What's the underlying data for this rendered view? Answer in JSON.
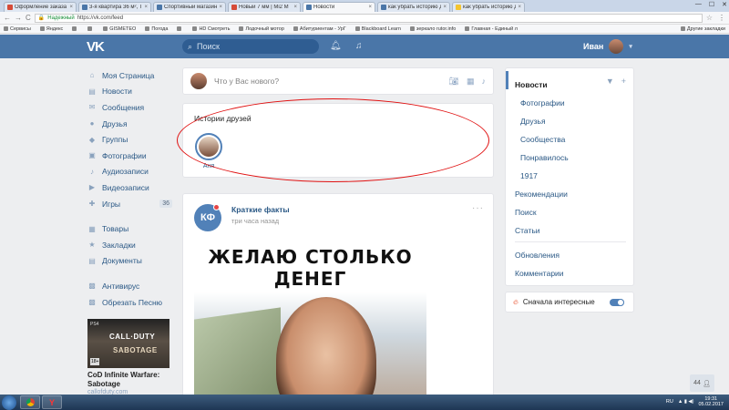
{
  "browser": {
    "tabs": [
      {
        "label": "Оформление заказа - Я",
        "color": "#d64b38",
        "active": false
      },
      {
        "label": "3-я квартира 36 м², Тб",
        "color": "#4a76a8",
        "active": false
      },
      {
        "label": "Спортивный магазин",
        "color": "#4a76a8",
        "active": false
      },
      {
        "label": "Новый 7 мм | Mi2 М",
        "color": "#d64b38",
        "active": false
      },
      {
        "label": "Новости",
        "color": "#4a76a8",
        "active": true
      },
      {
        "label": "как убрать историю дру",
        "color": "#4a76a8",
        "active": false
      },
      {
        "label": "как убрать историю дру",
        "color": "#f4c430",
        "active": false
      }
    ],
    "nav_back": "←",
    "nav_forward": "→",
    "reload": "C",
    "secure_label": "Надежный",
    "url": "https://vk.com/feed",
    "bookmarks": [
      "Сервисы",
      "Яндекс",
      "",
      "",
      "GISMETEO",
      "Погода",
      "",
      "HD Смотреть",
      "Лодочный мотор",
      "Абитуриентам - УрГ",
      "Blackboard Learn",
      "зеркало rutor.info",
      "Главная - Единый л"
    ],
    "other_bookmarks": "Другие закладки"
  },
  "header": {
    "logo": "VK",
    "search_placeholder": "Поиск",
    "user_name": "Иван"
  },
  "left_nav": {
    "group1": [
      {
        "label": "Моя Страница",
        "icon": "home-icon",
        "glyph": "⌂"
      },
      {
        "label": "Новости",
        "icon": "news-icon",
        "glyph": "▤"
      },
      {
        "label": "Сообщения",
        "icon": "messages-icon",
        "glyph": "✉"
      },
      {
        "label": "Друзья",
        "icon": "friends-icon",
        "glyph": "●"
      },
      {
        "label": "Группы",
        "icon": "groups-icon",
        "glyph": "◆"
      },
      {
        "label": "Фотографии",
        "icon": "photos-icon",
        "glyph": "▣"
      },
      {
        "label": "Аудиозаписи",
        "icon": "audio-icon",
        "glyph": "♪"
      },
      {
        "label": "Видеозаписи",
        "icon": "video-icon",
        "glyph": "▶"
      },
      {
        "label": "Игры",
        "icon": "games-icon",
        "glyph": "✚",
        "count": "36"
      }
    ],
    "group2": [
      {
        "label": "Товары",
        "icon": "goods-icon",
        "glyph": "▦"
      },
      {
        "label": "Закладки",
        "icon": "bookmarks-icon",
        "glyph": "★"
      },
      {
        "label": "Документы",
        "icon": "documents-icon",
        "glyph": "▤"
      }
    ],
    "group3": [
      {
        "label": "Антивирус",
        "icon": "antivirus-icon",
        "glyph": "▩"
      },
      {
        "label": "Обрезать Песню",
        "icon": "app-icon",
        "glyph": "▩"
      }
    ]
  },
  "ad": {
    "platform": "PS4",
    "image_line1": "CALL·DUTY",
    "image_line2": "SABOTAGE",
    "age": "18+",
    "title": "CoD Infinite Warfare: Sabotage",
    "url": "callofduty.com"
  },
  "composer": {
    "placeholder": "Что у Вас нового?"
  },
  "stories": {
    "title": "Истории друзей",
    "items": [
      {
        "name": "Аня"
      }
    ]
  },
  "post": {
    "avatar_text": "КФ",
    "author": "Краткие факты",
    "time": "три часа назад",
    "more": "···",
    "image_line1": "ЖЕЛАЮ СТОЛЬКО",
    "image_line2": "ДЕНЕГ"
  },
  "right_menu": {
    "items": [
      {
        "label": "Новости",
        "active": true,
        "sub": false
      },
      {
        "label": "Фотографии",
        "active": false,
        "sub": true
      },
      {
        "label": "Друзья",
        "active": false,
        "sub": true
      },
      {
        "label": "Сообщества",
        "active": false,
        "sub": true
      },
      {
        "label": "Понравилось",
        "active": false,
        "sub": true
      },
      {
        "label": "1917",
        "active": false,
        "sub": true
      },
      {
        "label": "Рекомендации",
        "active": false,
        "sub": false
      },
      {
        "label": "Поиск",
        "active": false,
        "sub": false
      },
      {
        "label": "Статьи",
        "active": false,
        "sub": false
      },
      {
        "label": "Обновления",
        "active": false,
        "sub": false
      },
      {
        "label": "Комментарии",
        "active": false,
        "sub": false
      }
    ],
    "toggle_label": "Сначала интересные",
    "toggle_on": true
  },
  "chat": {
    "count": "44"
  },
  "taskbar": {
    "lang": "RU",
    "time": "19:31",
    "date": "05.02.2017"
  }
}
